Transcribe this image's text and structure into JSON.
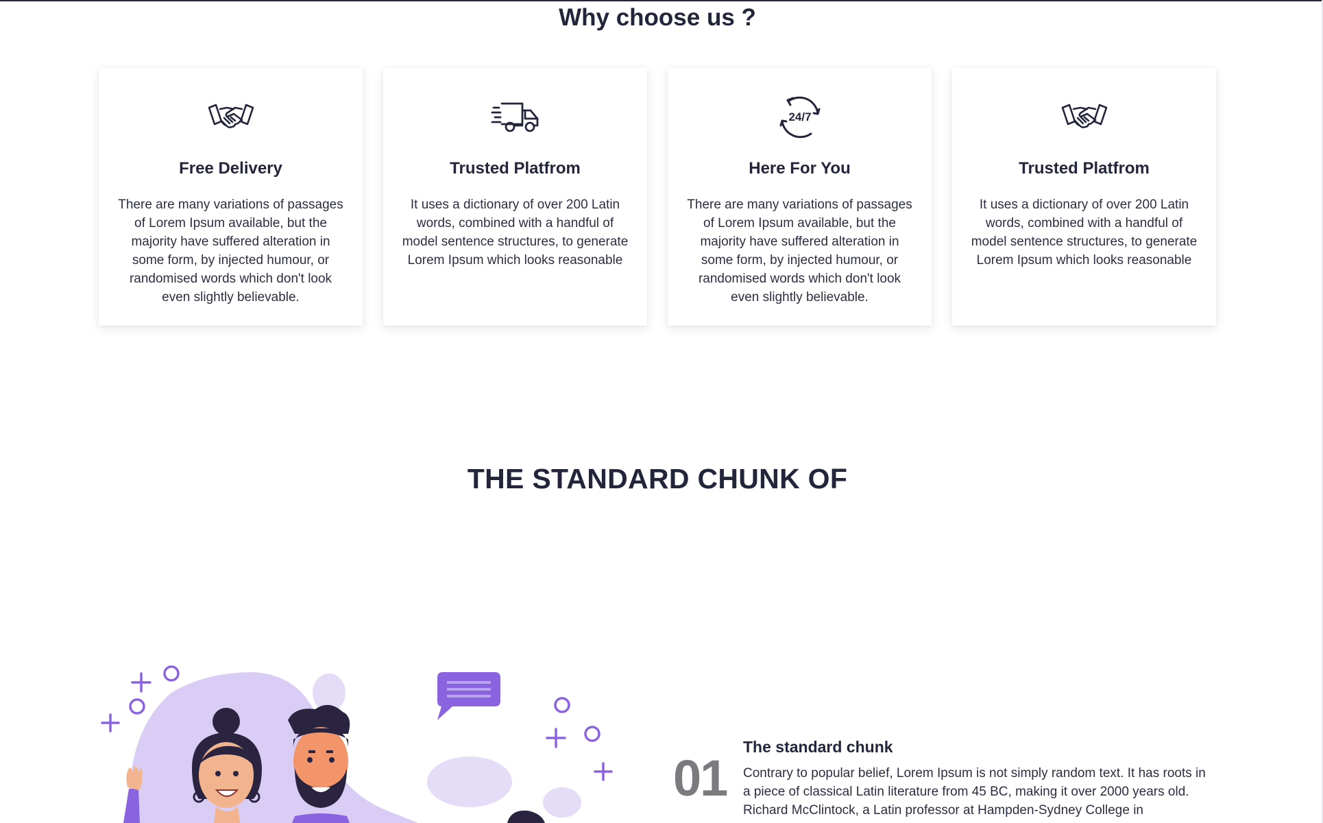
{
  "why_section": {
    "title": "Why choose us ?",
    "cards": [
      {
        "icon": "handshake-icon",
        "title": "Free Delivery",
        "text": "There are many variations of passages of Lorem Ipsum available, but the majority have suffered alteration in some form, by injected humour, or randomised words which don't look even slightly believable."
      },
      {
        "icon": "delivery-truck-icon",
        "title": "Trusted Platfrom",
        "text": "It uses a dictionary of over 200 Latin words, combined with a handful of model sentence structures, to generate Lorem Ipsum which looks reasonable"
      },
      {
        "icon": "clock-24-7-icon",
        "icon_text": "24/7",
        "title": "Here For You",
        "text": "There are many variations of passages of Lorem Ipsum available, but the majority have suffered alteration in some form, by injected humour, or randomised words which don't look even slightly believable."
      },
      {
        "icon": "handshake-icon",
        "title": "Trusted Platfrom",
        "text": "It uses a dictionary of over 200 Latin words, combined with a handful of model sentence structures, to generate Lorem Ipsum which looks reasonable"
      }
    ]
  },
  "standard_section": {
    "title": "THE STANDARD CHUNK OF",
    "illustration": "people-chat-illustration",
    "steps": [
      {
        "number": "01",
        "title": "The standard chunk",
        "text": "Contrary to popular belief, Lorem Ipsum is not simply random text. It has roots in a piece of classical Latin literature from 45 BC, making it over 2000 years old. Richard McClintock, a Latin professor at Hampden-Sydney College in"
      }
    ]
  },
  "colors": {
    "heading": "#23263a",
    "body_text": "#2b2e40",
    "step_number": "#7b7b7f",
    "accent_purple": "#8a63e0",
    "light_purple": "#d9cdf5"
  }
}
